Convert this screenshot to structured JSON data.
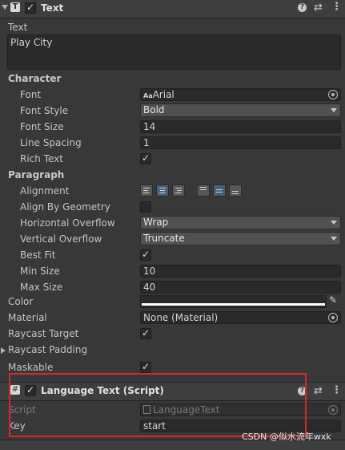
{
  "text_component": {
    "title": "Text",
    "text_label": "Text",
    "text_value": "Play City",
    "character_header": "Character",
    "font_label": "Font",
    "font_value": "Arial",
    "font_icon_text": "Aa",
    "font_style_label": "Font Style",
    "font_style_value": "Bold",
    "font_size_label": "Font Size",
    "font_size_value": "14",
    "line_spacing_label": "Line Spacing",
    "line_spacing_value": "1",
    "rich_text_label": "Rich Text",
    "rich_text_checked": true,
    "paragraph_header": "Paragraph",
    "alignment_label": "Alignment",
    "align_by_geometry_label": "Align By Geometry",
    "align_by_geometry_checked": false,
    "horizontal_overflow_label": "Horizontal Overflow",
    "horizontal_overflow_value": "Wrap",
    "vertical_overflow_label": "Vertical Overflow",
    "vertical_overflow_value": "Truncate",
    "best_fit_label": "Best Fit",
    "best_fit_checked": true,
    "min_size_label": "Min Size",
    "min_size_value": "10",
    "max_size_label": "Max Size",
    "max_size_value": "40",
    "color_label": "Color",
    "color_value": "#ffffff",
    "material_label": "Material",
    "material_value": "None (Material)",
    "raycast_target_label": "Raycast Target",
    "raycast_target_checked": true,
    "raycast_padding_label": "Raycast Padding",
    "maskable_label": "Maskable",
    "maskable_checked": true
  },
  "language_component": {
    "title": "Language Text (Script)",
    "script_label": "Script",
    "script_value": "LanguageText",
    "key_label": "Key",
    "key_value": "start"
  },
  "watermark": "CSDN @似水流年wxk",
  "colors": {
    "highlight_box": "#d9282b",
    "panel_bg": "#383838",
    "header_bg": "#3e3e3e"
  }
}
